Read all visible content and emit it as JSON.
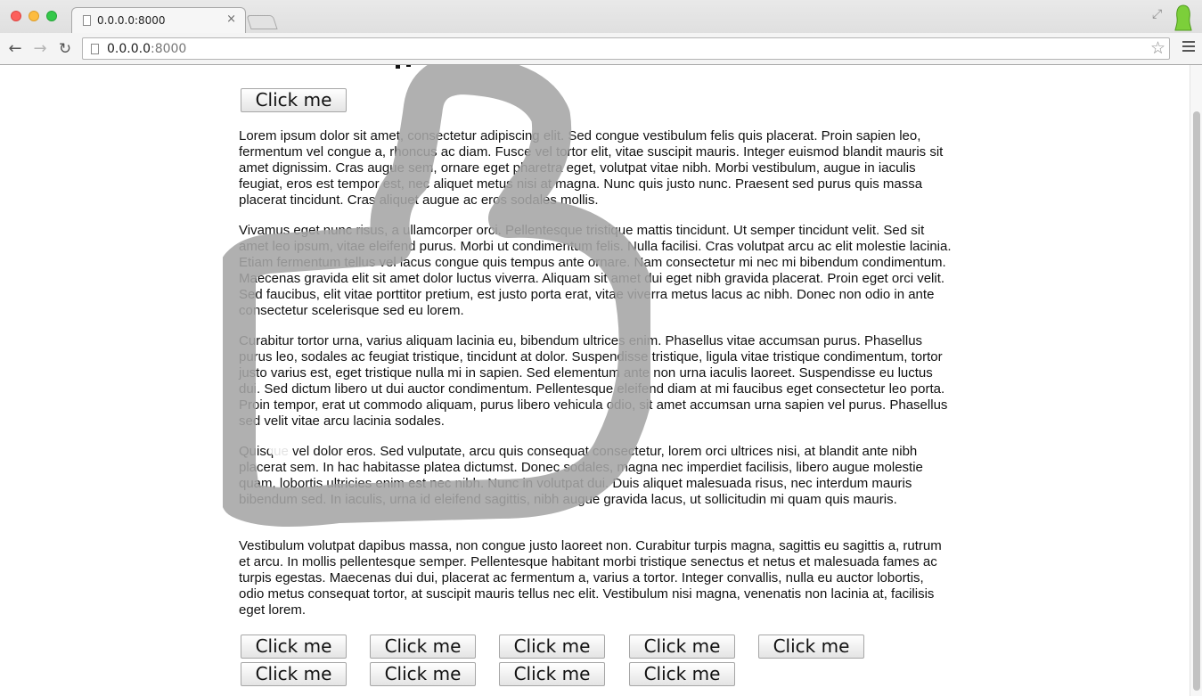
{
  "browser": {
    "tab_title": "0.0.0.0:8000",
    "tab_close_glyph": "×",
    "url_host": "0.0.0.0",
    "url_port": ":8000",
    "icons": {
      "back": "back-arrow-icon",
      "forward": "forward-arrow-icon",
      "reload": "reload-icon",
      "star": "bookmark-star-icon",
      "menu": "hamburger-menu-icon"
    }
  },
  "page": {
    "top_button": "Click me",
    "paragraphs": [
      "Lorem ipsum dolor sit amet, consectetur adipiscing elit. Sed congue vestibulum felis quis placerat. Proin sapien leo, fermentum vel congue a, rhoncus ac diam. Fusce vel tortor elit, vitae suscipit mauris. Integer euismod blandit mauris sit amet dignissim. Cras augue sem, ornare eget pharetra eget, volutpat vitae nibh. Morbi vestibulum, augue in iaculis feugiat, eros est tempor est, nec aliquet metus nisi at magna. Nunc quis justo nunc. Praesent sed purus quis massa placerat tincidunt. Cras aliquet augue ac eros sodales mollis.",
      "Vivamus eget nunc risus, a ullamcorper orci. Pellentesque tristique mattis tincidunt. Ut semper tincidunt velit. Sed sit amet leo ipsum, vitae eleifend purus. Morbi ut condimentum felis. Nulla facilisi. Cras volutpat arcu ac elit molestie lacinia. Etiam fermentum tellus vel lacus congue quis tempus ante ornare. Nam consectetur mi nec mi bibendum condimentum. Maecenas gravida elit sit amet dolor luctus viverra. Aliquam sit amet dui eget nibh gravida placerat. Proin eget orci velit. Sed faucibus, elit vitae porttitor pretium, est justo porta erat, vitae viverra metus lacus ac nibh. Donec non odio in ante consectetur scelerisque sed eu lorem.",
      "Curabitur tortor urna, varius aliquam lacinia eu, bibendum ultrices enim. Phasellus vitae accumsan purus. Phasellus purus leo, sodales ac feugiat tristique, tincidunt at dolor. Suspendisse tristique, ligula vitae tristique condimentum, tortor justo varius est, eget tristique nulla mi in sapien. Sed elementum ante non urna iaculis laoreet. Suspendisse eu luctus dui. Sed dictum libero ut dui auctor condimentum. Pellentesque eleifend diam at mi faucibus eget consectetur leo porta. Proin tempor, erat ut commodo aliquam, purus libero vehicula odio, sit amet accumsan urna sapien vel purus. Phasellus sed velit vitae arcu lacinia sodales.",
      "Quisque vel dolor eros. Sed vulputate, arcu quis consequat consectetur, lorem orci ultrices nisi, at blandit ante nibh placerat sem. In hac habitasse platea dictumst. Donec sodales, magna nec imperdiet facilisis, libero augue molestie quam, lobortis ultricies enim est nec nibh. Nunc in volutpat dui. Duis aliquet malesuada risus, nec interdum mauris bibendum sed. In iaculis, urna id eleifend sagittis, nibh augue gravida lacus, ut sollicitudin mi quam quis mauris.",
      "Vestibulum volutpat dapibus massa, non congue justo laoreet non. Curabitur turpis magna, sagittis eu sagittis a, rutrum et arcu. In mollis pellentesque semper. Pellentesque habitant morbi tristique senectus et netus et malesuada fames ac turpis egestas. Maecenas dui dui, placerat ac fermentum a, varius a tortor. Integer convallis, nulla eu auctor lobortis, odio metus consequat tortor, at suscipit mauris tellus nec elit. Vestibulum nisi magna, venenatis non lacinia at, facilisis eget lorem."
    ],
    "bottom_buttons": [
      "Click me",
      "Click me",
      "Click me",
      "Click me",
      "Click me",
      "Click me",
      "Click me",
      "Click me",
      "Click me"
    ],
    "watermark_icon": "hand-cursor-icon",
    "watermark_color": "#a5a5a5"
  }
}
